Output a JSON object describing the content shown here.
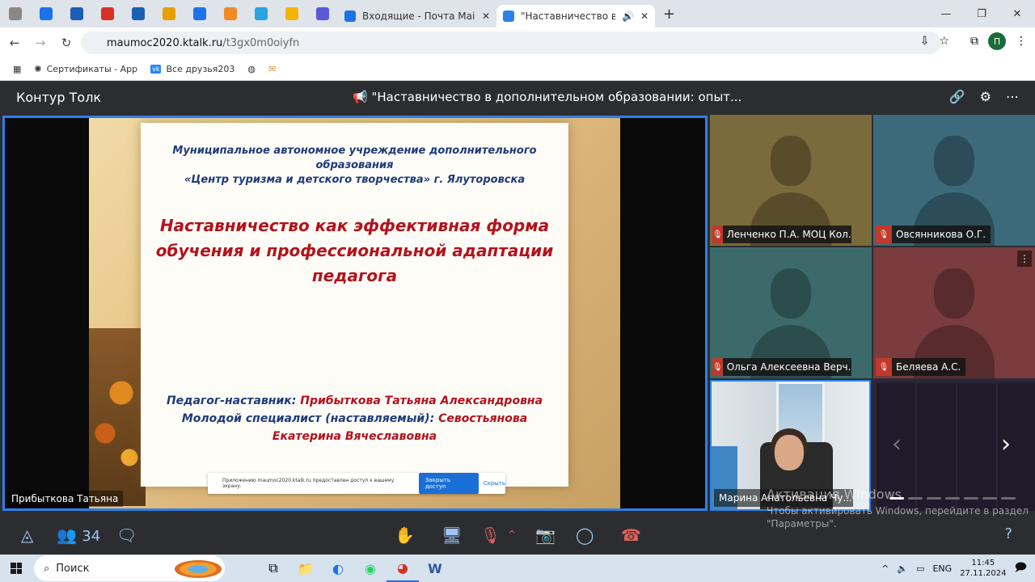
{
  "browser": {
    "tabs": [
      {
        "label": "Входящие - Почта Mail",
        "color": "#1a73e8"
      },
      {
        "label": "\"Наставничество в дополн",
        "color": "#2f7fe8"
      }
    ],
    "pinned_tab_colors": [
      "#888888",
      "#1a73e8",
      "#1a5fb4",
      "#d93025",
      "#1a5fb4",
      "#e5a000",
      "#1a73e8",
      "#f08a24",
      "#2aa3e0",
      "#f5b400",
      "#5a5ad6"
    ],
    "new_tab": "+",
    "url_domain": "maumoc2020.ktalk.ru",
    "url_path": "/t3gx0m0oiyfn",
    "profile_initial": "П",
    "bookmarks": [
      "Сертификаты - App",
      "Все друзья203"
    ]
  },
  "app": {
    "brand": "Контур Толк",
    "meeting_title": "\"Наставничество в дополнительном образовании: опыт...",
    "presenter_label": "Прибыткова Татьяна",
    "participants_count": "34",
    "slide": {
      "org_line1": "Муниципальное автономное учреждение дополнительного образования",
      "org_line2": "«Центр туризма и детского творчества» г. Ялуторовска",
      "title": "Наставничество как эффективная форма обучения и профессиональной адаптации педагога",
      "mentor_label": "Педагог-наставник: ",
      "mentor_name": "Прибыткова Татьяна Александровна",
      "young_label": "Молодой специалист (наставляемый): ",
      "young_name": "Севостьянова Екатерина Вячеславовна"
    },
    "share_notice": {
      "text": "Приложению maumoc2020.ktalk.ru предоставлен доступ к вашему экрану.",
      "stop": "Закрыть доступ",
      "hide": "Скрыть"
    },
    "tiles": [
      {
        "name": "Ленченко П.А. МОЦ Кол...",
        "bg": "#7a6a3c"
      },
      {
        "name": "Овсянникова О.Г.",
        "bg": "#3c6a7a"
      },
      {
        "name": "Ольга Алексеевна Верч...",
        "bg": "#3c6a6a"
      },
      {
        "name": "Беляева А.С.",
        "bg": "#7a3c3e"
      }
    ],
    "cam_tile_name": "Марина Анатольевна Чу...",
    "activation_title": "Активация Windows",
    "activation_text": "Чтобы активировать Windows, перейдите в раздел \"Параметры\"."
  },
  "taskbar": {
    "search": "Поиск",
    "lang": "ENG",
    "time": "11:45",
    "date": "27.11.2024"
  }
}
